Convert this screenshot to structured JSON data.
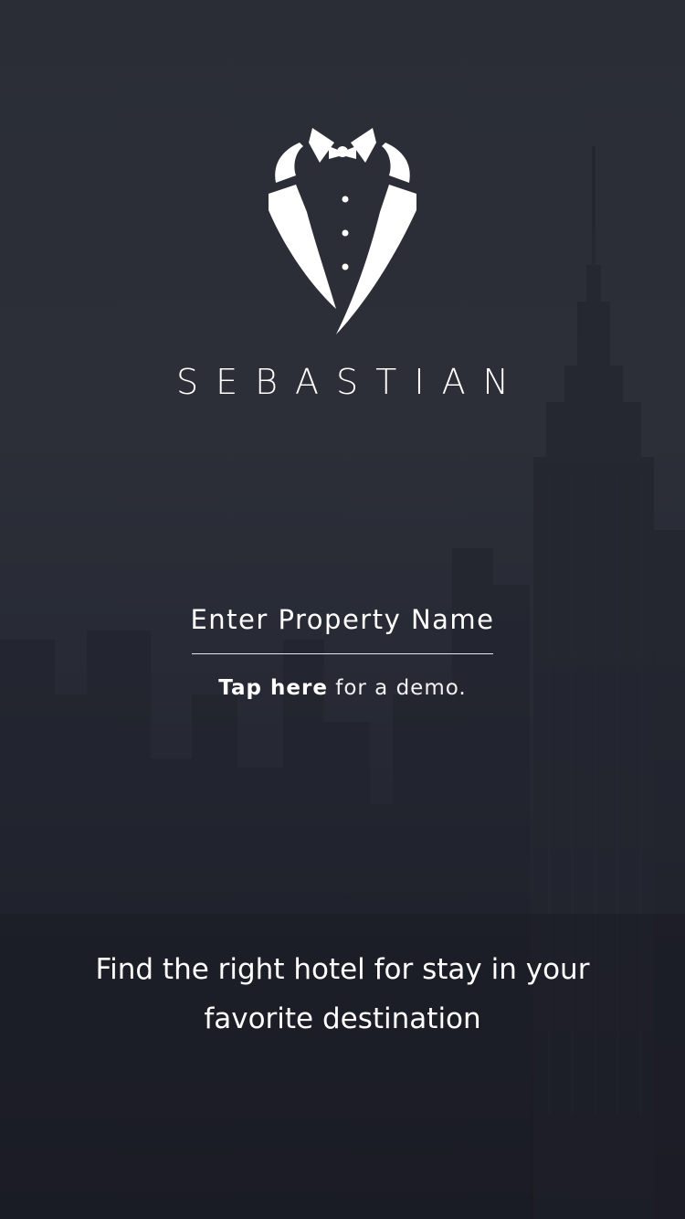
{
  "app": {
    "brand_name": "SEBASTIAN",
    "logo_icon": "tuxedo-icon"
  },
  "property_search": {
    "placeholder": "Enter Property Name",
    "value": ""
  },
  "demo": {
    "link_label": "Tap here",
    "suffix": " for a demo."
  },
  "tagline": "Find the right hotel for stay in your favorite destination",
  "colors": {
    "background_top": "#2a2d36",
    "background_bottom": "#1b1d25",
    "text": "#ffffff",
    "skyline": "#1f222b"
  }
}
